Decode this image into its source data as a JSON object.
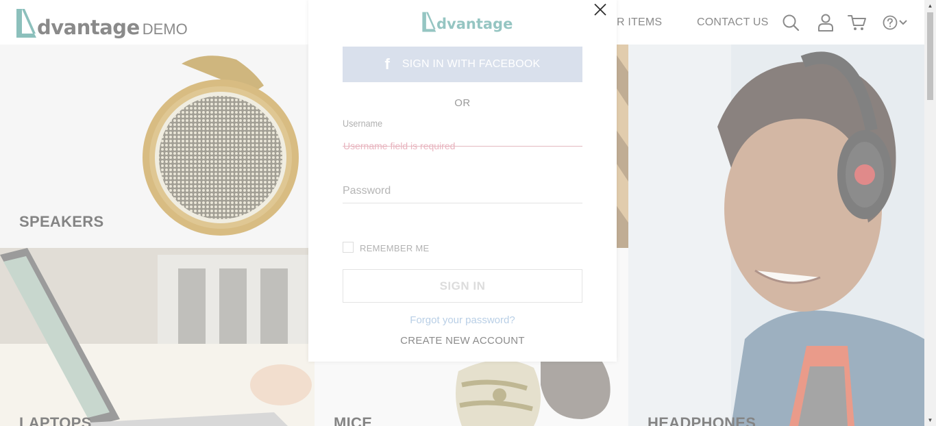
{
  "header": {
    "logo_text": "dvantage",
    "logo_suffix": "DEMO",
    "nav": {
      "popular_items": "LAR ITEMS",
      "contact_us": "CONTACT US"
    },
    "icons": [
      "search-icon",
      "user-icon",
      "cart-icon",
      "help-icon",
      "chevron-down-icon"
    ]
  },
  "categories": {
    "speakers": "SPEAKERS",
    "laptops": "LAPTOPS",
    "mice": "MICE",
    "headphones": "HEADPHONES"
  },
  "login_modal": {
    "logo_text": "dvantage",
    "facebook_button": "SIGN IN WITH FACEBOOK",
    "or": "OR",
    "username_label": "Username",
    "username_value": "",
    "username_error": "Username field is required",
    "password_placeholder": "Password",
    "password_value": "",
    "remember_me": "REMEMBER ME",
    "remember_checked": false,
    "sign_in_button": "SIGN IN",
    "forgot_password": "Forgot your password?",
    "create_account": "CREATE NEW ACCOUNT"
  },
  "colors": {
    "brand_teal": "#2e8c86",
    "facebook_button_bg": "#d9e0ec",
    "error_text": "#e9b4bf",
    "link_blue": "#b9cfe6"
  }
}
